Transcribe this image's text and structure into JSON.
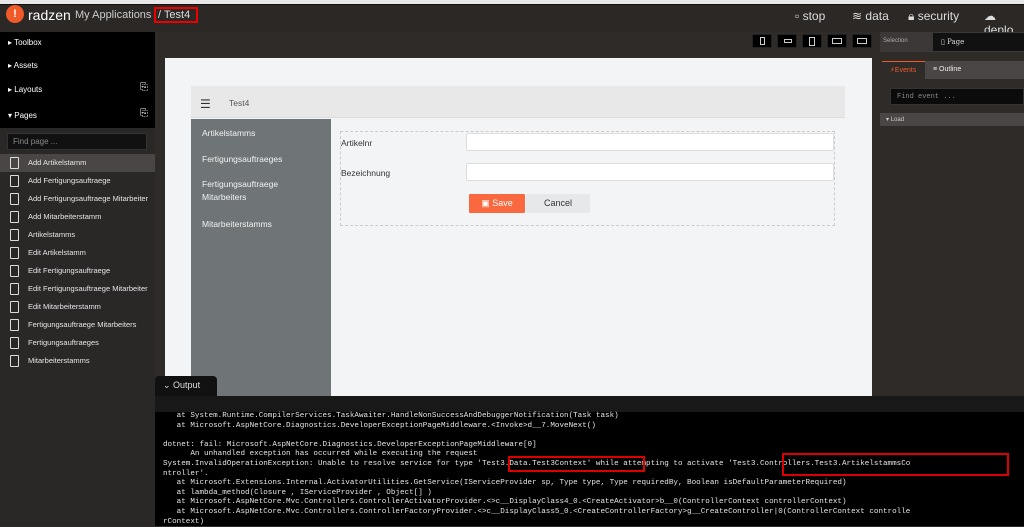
{
  "header": {
    "logo": "radzen",
    "breadcrumb": "My Applications",
    "current": "/ Test4",
    "nav": [
      {
        "label": "stop",
        "icon": "stop-icon"
      },
      {
        "label": "data",
        "icon": "database-icon"
      },
      {
        "label": "security",
        "icon": "lock-icon"
      },
      {
        "label": "deplo",
        "icon": "cloud-upload-icon"
      }
    ]
  },
  "left": {
    "sections": [
      "Toolbox",
      "Assets",
      "Layouts",
      "Pages"
    ],
    "find_placeholder": "Find page ...",
    "pages": [
      "Add Artikelstamm",
      "Add Fertigungsauftraege",
      "Add Fertigungsauftraege Mitarbeiter",
      "Add Mitarbeiterstamm",
      "Artikelstamms",
      "Edit Artikelstamm",
      "Edit Fertigungsauftraege",
      "Edit Fertigungsauftraege Mitarbeiter",
      "Edit Mitarbeiterstamm",
      "Fertigungsauftraege Mitarbeiters",
      "Fertigungsauftraeges",
      "Mitarbeiterstamms"
    ],
    "selected": "Add Artikelstamm"
  },
  "canvas": {
    "title": "Test4",
    "nav": [
      "Artikelstamms",
      "Fertigungsauftraeges",
      "Fertigungsauftraege Mitarbeiters",
      "Mitarbeiterstamms"
    ],
    "fields": [
      {
        "label": "Artikelnr",
        "value": ""
      },
      {
        "label": "Bezeichnung",
        "value": ""
      }
    ],
    "save": "Save",
    "cancel": "Cancel"
  },
  "right": {
    "selection_label": "Selection",
    "selection_value": "Page",
    "tabs": [
      "Events",
      "Outline"
    ],
    "active_tab": "Events",
    "find_placeholder": "Find event ...",
    "group": "Load"
  },
  "output": {
    "title": "Output",
    "lines": [
      "   at System.Runtime.CompilerServices.TaskAwaiter.HandleNonSuccessAndDebuggerNotification(Task task)",
      "   at Microsoft.AspNetCore.Diagnostics.DeveloperExceptionPageMiddleware.<Invoke>d__7.MoveNext()",
      "",
      "dotnet: fail: Microsoft.AspNetCore.Diagnostics.DeveloperExceptionPageMiddleware[0]",
      "      An unhandled exception has occurred while executing the request",
      "System.InvalidOperationException: Unable to resolve service for type 'Test3.Data.Test3Context' while attempting to activate 'Test3.Controllers.Test3.ArtikelstammsCo",
      "ntroller'.",
      "   at Microsoft.Extensions.Internal.ActivatorUtilities.GetService(IServiceProvider sp, Type type, Type requiredBy, Boolean isDefaultParameterRequired)",
      "   at lambda_method(Closure , IServiceProvider , Object[] )",
      "   at Microsoft.AspNetCore.Mvc.Controllers.ControllerActivatorProvider.<>c__DisplayClass4_0.<CreateActivator>b__0(ControllerContext controllerContext)",
      "   at Microsoft.AspNetCore.Mvc.Controllers.ControllerFactoryProvider.<>c__DisplayClass5_0.<CreateControllerFactory>g__CreateController|0(ControllerContext controlle",
      "rContext)"
    ]
  },
  "colors": {
    "accent": "#f05a28",
    "save": "#f9683e",
    "highlight": "#dd0000"
  }
}
